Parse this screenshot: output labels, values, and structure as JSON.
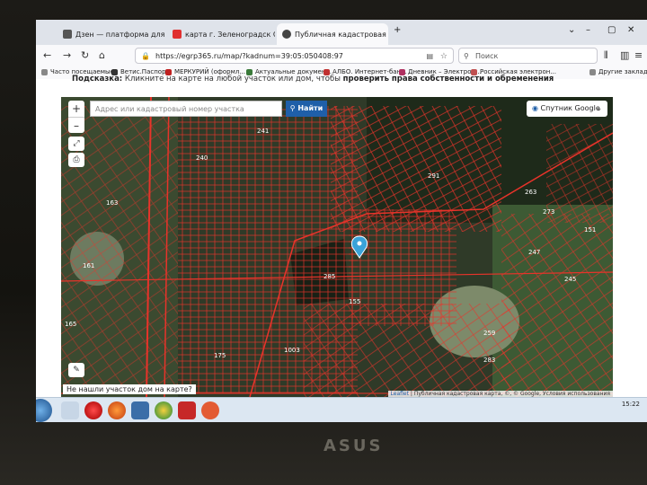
{
  "browser": {
    "tabs": [
      {
        "label": "Дзен — платформа для просм",
        "favicon_color": "#555555"
      },
      {
        "label": "карта г. Зеленоградск СНТ Со",
        "favicon_color": "#e03030"
      },
      {
        "label": "Публичная кадастровая карта",
        "favicon_color": "#444444",
        "active": true
      }
    ],
    "url": "https://egrp365.ru/map/?kadnum=39:05:050408:97",
    "search_placeholder": "Поиск",
    "bookmarks": [
      {
        "label": "Часто посещаемые",
        "color": "#888888"
      },
      {
        "label": "Ветис.Паспорт",
        "color": "#333333"
      },
      {
        "label": "МЕРКУРИЙ (оформл...",
        "color": "#c02020"
      },
      {
        "label": "Актуальные докумен...",
        "color": "#3a7a3a"
      },
      {
        "label": "АЛБО. Интернет-бан...",
        "color": "#c03030"
      },
      {
        "label": "Дневник – Электрон...",
        "color": "#b03060"
      },
      {
        "label": "Российская электрон...",
        "color": "#c05050"
      },
      {
        "label": "Другие закладки",
        "color": "#888888"
      }
    ]
  },
  "page": {
    "hint_prefix": "Подсказка:",
    "hint_text": "Кликните на карте на любой участок или дом, чтобы",
    "hint_bold": "проверить права собственности и обременения",
    "map": {
      "search_placeholder": "Адрес или кадастровый номер участка",
      "find_button": "Найти",
      "layer_select": "Спутник Google",
      "zoom_in": "+",
      "zoom_out": "–",
      "not_found": "Не нашли участок дом на карте?",
      "attribution_leaflet": "Leaflet",
      "attribution_text": "| Публичная кадастровая карта, ©, © Google, Условия использования",
      "labels": [
        "241",
        "240",
        "163",
        "161",
        "165",
        "285",
        "155",
        "175",
        "263",
        "273",
        "291",
        "259",
        "247",
        "245",
        "151",
        "283",
        "1003"
      ]
    }
  },
  "taskbar": {
    "time": "15:22"
  },
  "bezel_brand": "ASUS"
}
